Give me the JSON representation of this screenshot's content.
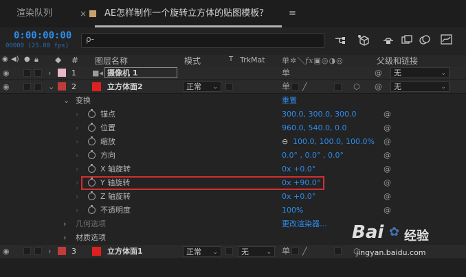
{
  "tabs": {
    "render_queue": "渲染队列",
    "comp": "AE怎样制作一个旋转立方体的贴图模板？",
    "close": "×",
    "menu": "≡"
  },
  "time": {
    "timecode": "0:00:00:00",
    "frames": "00000 (25.00 fps)"
  },
  "search": {
    "placeholder": "",
    "icon": "ρ-"
  },
  "columns": {
    "num": "#",
    "layer_name": "图层名称",
    "mode": "模式",
    "t": "T",
    "trkmat": "TrkMat",
    "parent": "父级和链接"
  },
  "layers": [
    {
      "num": "1",
      "name": "摄像机 1",
      "swatch": "#e8b7c5",
      "parent": "无"
    },
    {
      "num": "2",
      "name": "立方体面2",
      "swatch": "#c23b3b",
      "color_box": "#e02020",
      "mode": "正常",
      "parent": "无"
    },
    {
      "num": "3",
      "name": "立方体面1",
      "swatch": "#c23b3b",
      "color_box": "#e02020",
      "mode": "正常",
      "trkmat": "无",
      "parent": "无"
    }
  ],
  "transform": {
    "label": "变换",
    "reset": "重置"
  },
  "properties": [
    {
      "name": "锚点",
      "value": "300.0, 300.0, 300.0"
    },
    {
      "name": "位置",
      "value": "960.0, 540.0, 0.0"
    },
    {
      "name": "缩放",
      "value": "100.0, 100.0, 100.0%",
      "link_icon": "⊖"
    },
    {
      "name": "方向",
      "value": "0.0° , 0.0° , 0.0°"
    },
    {
      "name": "X 轴旋转",
      "value": "0x +0.0°"
    },
    {
      "name": "Y 轴旋转",
      "value": "0x +90.0°"
    },
    {
      "name": "Z 轴旋转",
      "value": "0x +0.0°"
    },
    {
      "name": "不透明度",
      "value": "100%"
    }
  ],
  "geometry": {
    "label": "几何选项",
    "action": "更改渲染器..."
  },
  "material": {
    "label": "材质选项"
  },
  "watermark": {
    "brand": "Bai",
    "brand2": "经验",
    "url": "jingyan.baidu.com"
  },
  "colors": {
    "accent": "#2d8ceb",
    "highlight": "#d23030"
  }
}
